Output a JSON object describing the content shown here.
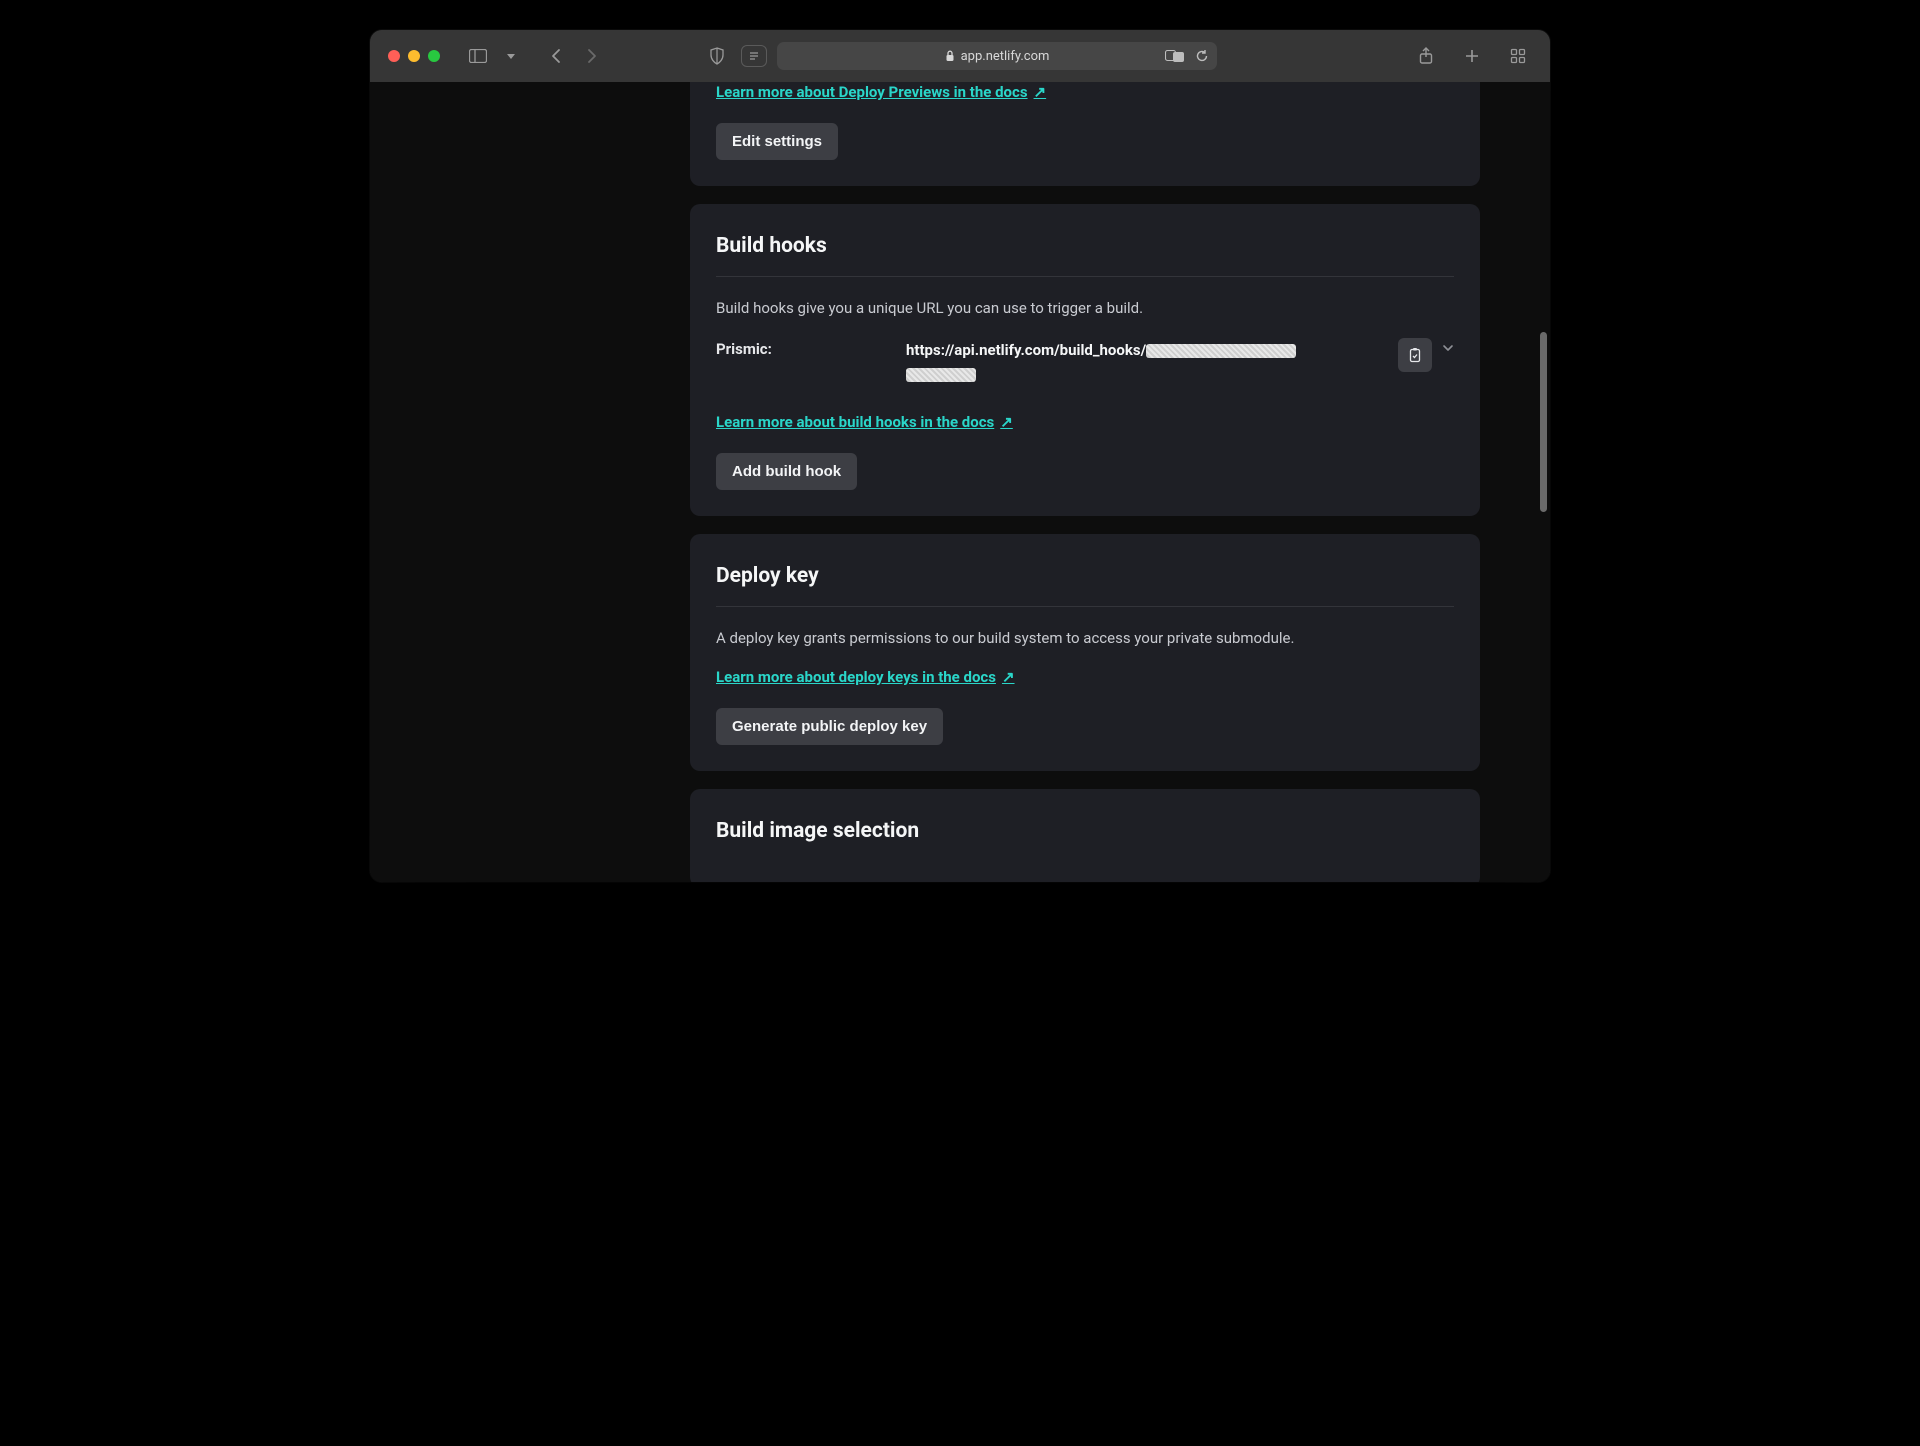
{
  "browser": {
    "url_host": "app.netlify.com"
  },
  "deploy_previews": {
    "docs_link": "Learn more about Deploy Previews in the docs",
    "edit_button": "Edit settings"
  },
  "build_hooks": {
    "title": "Build hooks",
    "description": "Build hooks give you a unique URL you can use to trigger a build.",
    "hook_label": "Prismic:",
    "hook_url_prefix": "https://api.netlify.com/build_hooks/",
    "docs_link": "Learn more about build hooks in the docs",
    "add_button": "Add build hook"
  },
  "deploy_key": {
    "title": "Deploy key",
    "description": "A deploy key grants permissions to our build system to access your private submodule.",
    "docs_link": "Learn more about deploy keys in the docs",
    "generate_button": "Generate public deploy key"
  },
  "build_image": {
    "title": "Build image selection"
  }
}
